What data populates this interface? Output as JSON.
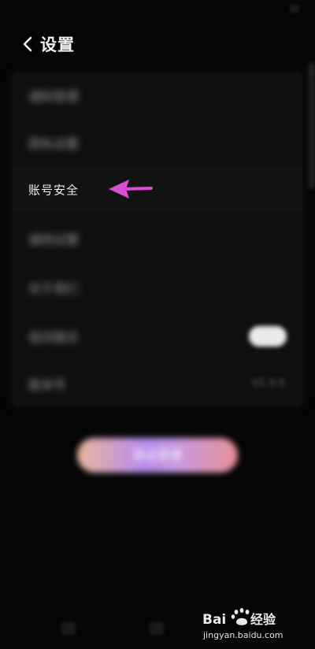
{
  "header": {
    "title": "设置"
  },
  "settings": {
    "items": [
      {
        "label": "通知管理",
        "blurred": true
      },
      {
        "label": "隐私设置",
        "blurred": true
      },
      {
        "label": "账号安全",
        "blurred": false
      },
      {
        "label": "通用设置",
        "blurred": true
      },
      {
        "label": "关于我们",
        "blurred": true
      },
      {
        "label": "夜间模式",
        "blurred": true,
        "toggle": true
      },
      {
        "label": "版本号",
        "blurred": true,
        "value": "V1.0.0"
      }
    ]
  },
  "action_button": {
    "label": "退出登录"
  },
  "colors": {
    "annotation_arrow": "#d94fd2",
    "background": "#050505",
    "list_background": "#0f0f0f"
  },
  "watermark": {
    "brand": "Baidu经验",
    "url": "jingyan.baidu.com"
  }
}
